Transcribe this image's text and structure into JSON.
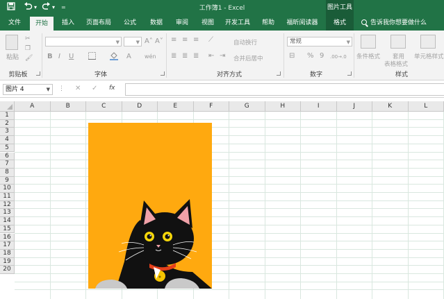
{
  "titlebar": {
    "title": "工作簿1  -  Excel",
    "picture_tools": "图片工具",
    "undo_dd": "▾",
    "redo_dd": "▾",
    "customize": "="
  },
  "tabs": [
    {
      "label": "文件"
    },
    {
      "label": "开始"
    },
    {
      "label": "插入"
    },
    {
      "label": "页面布局"
    },
    {
      "label": "公式"
    },
    {
      "label": "数据"
    },
    {
      "label": "审阅"
    },
    {
      "label": "视图"
    },
    {
      "label": "开发工具"
    },
    {
      "label": "帮助"
    },
    {
      "label": "福昕阅读器"
    },
    {
      "label": "格式"
    }
  ],
  "tell_me": "告诉我你想要做什么",
  "ribbon": {
    "clipboard": {
      "paste": "粘贴",
      "label": "剪贴板"
    },
    "font": {
      "label": "字体",
      "grow": "A˄",
      "shrink": "A˅",
      "bold": "B",
      "italic": "I",
      "underline": "U",
      "font_color": "A",
      "change_case": "wén"
    },
    "alignment": {
      "label": "对齐方式",
      "wrap": "自动换行",
      "merge": "合并后居中"
    },
    "number": {
      "label": "数字",
      "format": "常规",
      "percent": "%",
      "comma": "9",
      "decimals_inc": ".00→.0",
      "decimals_dec": ".0→.00"
    },
    "styles": {
      "label": "样式",
      "conditional": "条件格式",
      "table1": "套用",
      "table2": "表格格式",
      "cell": "单元格样式"
    }
  },
  "formula_bar": {
    "name_box": "图片 4",
    "fx": "fx",
    "cancel": "✕",
    "enter": "✓",
    "dots": "⋮",
    "content": ""
  },
  "sheet": {
    "columns": [
      "A",
      "B",
      "C",
      "D",
      "E",
      "F",
      "G",
      "H",
      "I",
      "J",
      "K",
      "L"
    ],
    "rows": [
      "1",
      "2",
      "3",
      "4",
      "5",
      "6",
      "7",
      "8",
      "9",
      "10",
      "11",
      "12",
      "13",
      "14",
      "15",
      "16",
      "17",
      "18",
      "19",
      "20"
    ]
  },
  "colors": {
    "excel_green": "#217346",
    "format_tab": "#1a5c38",
    "ribbon_bg": "#f3f3f3",
    "picture_bg": "#ffa90f",
    "cat_fur": "#111111",
    "ear_inner": "#f0a1a8",
    "eye": "#f5d60a",
    "collar": "#e4401b",
    "bell": "#f5c400"
  },
  "icons": [
    "save-icon",
    "undo-icon",
    "redo-icon",
    "search-icon",
    "paste-icon",
    "cut-icon",
    "copy-icon",
    "format-painter-icon",
    "fill-color-icon",
    "border-icon",
    "cat-image"
  ]
}
